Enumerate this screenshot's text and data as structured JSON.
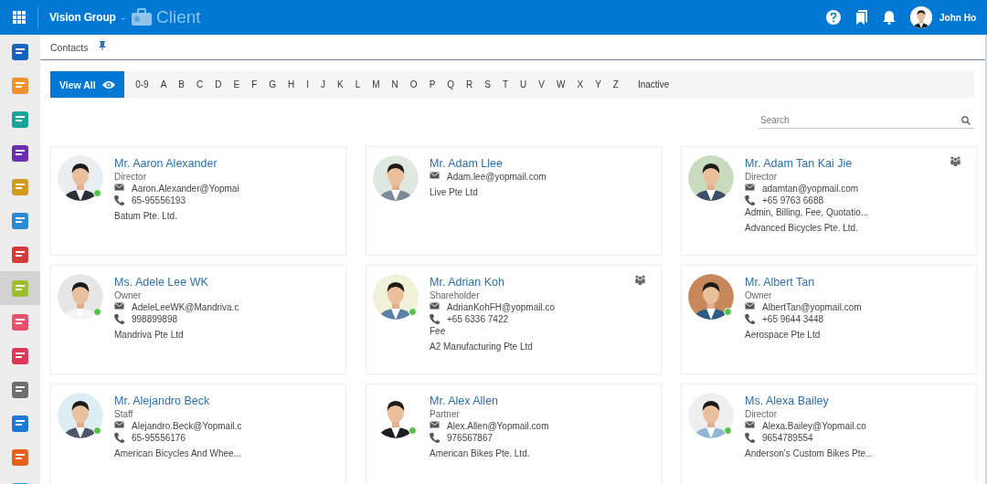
{
  "header": {
    "brand": "Vision Group",
    "separator": "-",
    "module": "Client",
    "user": {
      "name": "John Ho"
    }
  },
  "sidebar": {
    "items": [
      {
        "color": "#1565c0",
        "selected": false
      },
      {
        "color": "#f0922e",
        "selected": false
      },
      {
        "color": "#1aa39a",
        "selected": false
      },
      {
        "color": "#6a2fb0",
        "selected": false
      },
      {
        "color": "#d6991e",
        "selected": false
      },
      {
        "color": "#2a8ad6",
        "selected": false
      },
      {
        "color": "#d63a3a",
        "selected": false
      },
      {
        "color": "#9bbf2e",
        "selected": true
      },
      {
        "color": "#e8526a",
        "selected": false
      },
      {
        "color": "#e0365a",
        "selected": false
      },
      {
        "color": "#6d6d6d",
        "selected": false
      },
      {
        "color": "#1a7ad6",
        "selected": false
      },
      {
        "color": "#e8601e",
        "selected": false
      },
      {
        "color": "#2196d8",
        "selected": false
      }
    ]
  },
  "breadcrumb": {
    "label": "Contacts",
    "pinned": true
  },
  "filters": [
    {
      "label": "View All",
      "kind": "all",
      "selected": true
    },
    {
      "label": "0-9",
      "kind": "letter",
      "selected": false
    },
    {
      "label": "A",
      "kind": "letter",
      "selected": false
    },
    {
      "label": "B",
      "kind": "letter",
      "selected": false
    },
    {
      "label": "C",
      "kind": "letter",
      "selected": false
    },
    {
      "label": "D",
      "kind": "letter",
      "selected": false
    },
    {
      "label": "E",
      "kind": "letter",
      "selected": false
    },
    {
      "label": "F",
      "kind": "letter",
      "selected": false
    },
    {
      "label": "G",
      "kind": "letter",
      "selected": false
    },
    {
      "label": "H",
      "kind": "letter",
      "selected": false
    },
    {
      "label": "I",
      "kind": "letter",
      "selected": false
    },
    {
      "label": "J",
      "kind": "letter",
      "selected": false
    },
    {
      "label": "K",
      "kind": "letter",
      "selected": false
    },
    {
      "label": "L",
      "kind": "letter",
      "selected": false
    },
    {
      "label": "M",
      "kind": "letter",
      "selected": false
    },
    {
      "label": "N",
      "kind": "letter",
      "selected": false
    },
    {
      "label": "O",
      "kind": "letter",
      "selected": false
    },
    {
      "label": "P",
      "kind": "letter",
      "selected": false
    },
    {
      "label": "Q",
      "kind": "letter",
      "selected": false
    },
    {
      "label": "R",
      "kind": "letter",
      "selected": false
    },
    {
      "label": "S",
      "kind": "letter",
      "selected": false
    },
    {
      "label": "T",
      "kind": "letter",
      "selected": false
    },
    {
      "label": "U",
      "kind": "letter",
      "selected": false
    },
    {
      "label": "V",
      "kind": "letter",
      "selected": false
    },
    {
      "label": "W",
      "kind": "letter",
      "selected": false
    },
    {
      "label": "X",
      "kind": "letter",
      "selected": false
    },
    {
      "label": "Y",
      "kind": "letter",
      "selected": false
    },
    {
      "label": "Z",
      "kind": "letter",
      "selected": false
    },
    {
      "label": "Inactive",
      "kind": "letter",
      "selected": false
    }
  ],
  "search": {
    "placeholder": "Search"
  },
  "contacts": [
    {
      "name": "Mr. Aaron Alexander",
      "role": "Director",
      "email": "Aaron.Alexander@Yopmai",
      "phone": "65-95556193",
      "company": "Batum Pte. Ltd.",
      "online": true,
      "group": false
    },
    {
      "name": "Mr. Adam Llee",
      "email": "Adam.lee@yopmail.com",
      "company": "Live Pte Ltd",
      "online": false,
      "group": false
    },
    {
      "name": "Mr. Adam Tan Kai Jie",
      "role": "Director",
      "email": "adamtan@yopmail.com",
      "phone": "+65 9763 6688",
      "tags": "Admin, Billing, Fee, Quotatio...",
      "company": "Advanced Bicycles Pte. Ltd.",
      "online": false,
      "group": true
    },
    {
      "name": "Ms. Adele Lee WK",
      "role": "Owner",
      "email": "AdeleLeeWK@Mandriva.c",
      "phone": "998899898",
      "company": "Mandriva Pte Ltd",
      "online": true,
      "group": false
    },
    {
      "name": "Mr. Adrian Koh",
      "role": "Shareholder",
      "email": "AdrianKohFH@yopmail.co",
      "phone": "+65 6336 7422",
      "tags": "Fee",
      "company": "A2 Manufacturing Pte Ltd",
      "online": true,
      "group": true
    },
    {
      "name": "Mr. Albert Tan",
      "role": "Owner",
      "email": "AlbertTan@yopmail.com",
      "phone": "+65 9644 3448",
      "company": "Aerospace Pte Ltd",
      "online": true,
      "group": false
    },
    {
      "name": "Mr. Alejandro Beck",
      "role": "Staff",
      "email": "Alejandro.Beck@Yopmail.c",
      "phone": "65-95556176",
      "company": "American Bicycles And Whee...",
      "online": true,
      "group": false
    },
    {
      "name": "Mr. Alex Allen",
      "role": "Partner",
      "email": "Alex.Allen@Yopmail.com",
      "phone": "976567867",
      "company": "American Bikes Pte. Ltd.",
      "online": true,
      "group": false
    },
    {
      "name": "Ms. Alexa Bailey",
      "role": "Director",
      "email": "Alexa.Bailey@Yopmail.co",
      "phone": "9654789554",
      "company": "Anderson's Custom Bikes Pte...",
      "online": true,
      "group": false
    }
  ]
}
